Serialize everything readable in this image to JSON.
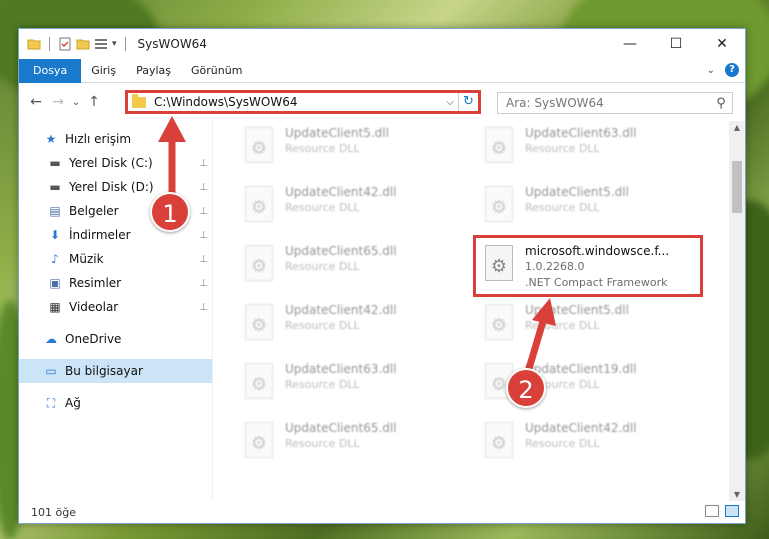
{
  "window": {
    "title": "SysWOW64",
    "controls": {
      "minimize": "—",
      "maximize": "☐",
      "close": "✕"
    }
  },
  "ribbon": {
    "tabs": [
      "Dosya",
      "Giriş",
      "Paylaş",
      "Görünüm"
    ],
    "active_tab": "Dosya",
    "expand_icon": "chevron-down-icon",
    "help_label": "?"
  },
  "address": {
    "path": "C:\\Windows\\SysWOW64",
    "refresh_glyph": "↻",
    "dropdown_glyph": "⌵"
  },
  "search": {
    "placeholder": "Ara: SysWOW64",
    "icon": "search-icon",
    "glyph": "⚲"
  },
  "nav": {
    "back_glyph": "←",
    "forward_glyph": "→",
    "recent_glyph": "⌄",
    "up_glyph": "↑",
    "items": [
      {
        "label": "Hızlı erişim",
        "icon": "star-icon",
        "glyph": "★",
        "color": "#2b78d0",
        "pinned": false
      },
      {
        "label": "Yerel Disk (C:)",
        "icon": "drive-icon",
        "glyph": "▬",
        "color": "#555555",
        "pinned": true
      },
      {
        "label": "Yerel Disk (D:)",
        "icon": "drive-icon",
        "glyph": "▬",
        "color": "#555555",
        "pinned": true
      },
      {
        "label": "Belgeler",
        "icon": "documents-icon",
        "glyph": "▤",
        "color": "#4a6fa5",
        "pinned": true
      },
      {
        "label": "İndirmeler",
        "icon": "downloads-icon",
        "glyph": "⬇",
        "color": "#2b78d0",
        "pinned": true
      },
      {
        "label": "Müzik",
        "icon": "music-icon",
        "glyph": "♪",
        "color": "#2b78d0",
        "pinned": true
      },
      {
        "label": "Resimler",
        "icon": "pictures-icon",
        "glyph": "▣",
        "color": "#4a6fa5",
        "pinned": true
      },
      {
        "label": "Videolar",
        "icon": "videos-icon",
        "glyph": "▦",
        "color": "#333333",
        "pinned": true
      },
      {
        "label": "OneDrive",
        "icon": "cloud-icon",
        "glyph": "☁",
        "color": "#2b78d0",
        "pinned": false
      },
      {
        "label": "Bu bilgisayar",
        "icon": "computer-icon",
        "glyph": "▭",
        "color": "#2b78d0",
        "pinned": false,
        "selected": true
      },
      {
        "label": "Ağ",
        "icon": "network-icon",
        "glyph": "⛶",
        "color": "#2b78d0",
        "pinned": false
      }
    ],
    "pin_glyph": "📌"
  },
  "files": [
    {
      "name": "UpdateClient5.dll",
      "sub": "Resource DLL",
      "blur": true
    },
    {
      "name": "UpdateClient63.dll",
      "sub": "Resource DLL",
      "blur": true
    },
    {
      "name": "UpdateClient42.dll",
      "sub": "Resource DLL",
      "blur": true
    },
    {
      "name": "UpdateClient5.dll",
      "sub": "Resource DLL",
      "blur": true
    },
    {
      "name": "UpdateClient65.dll",
      "sub": "Resource DLL",
      "blur": true
    },
    {
      "name": "microsoft.windowsce.f...",
      "version": "1.0.2268.0",
      "sub": ".NET Compact Framework",
      "blur": false
    },
    {
      "name": "UpdateClient42.dll",
      "sub": "Resource DLL",
      "blur": true
    },
    {
      "name": "UpdateClient5.dll",
      "sub": "Resource DLL",
      "blur": true
    },
    {
      "name": "UpdateClient63.dll",
      "sub": "Resource DLL",
      "blur": true
    },
    {
      "name": "UpdateClient19.dll",
      "sub": "Resource DLL",
      "blur": true
    },
    {
      "name": "UpdateClient65.dll",
      "sub": "Resource DLL",
      "blur": true
    },
    {
      "name": "UpdateClient42.dll",
      "sub": "Resource DLL",
      "blur": true
    }
  ],
  "status": {
    "count": "101 öğe"
  },
  "annotations": {
    "step1": "1",
    "step2": "2",
    "color": "#d9403a"
  }
}
